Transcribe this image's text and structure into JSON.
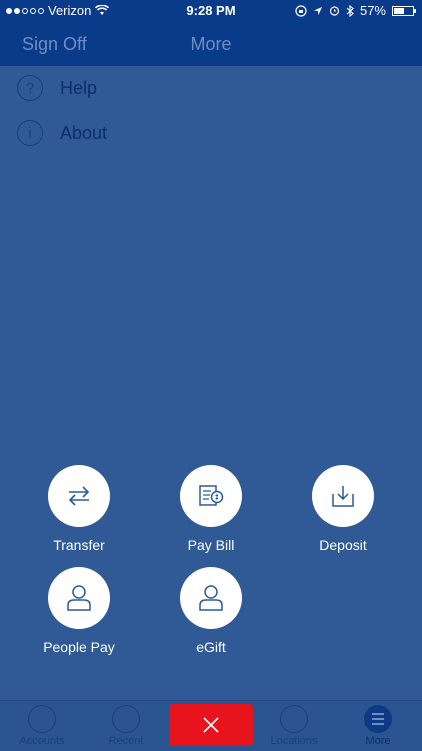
{
  "status_bar": {
    "carrier": "Verizon",
    "time": "9:28 PM",
    "battery": "57%",
    "battery_level": 0.57,
    "signal_bars_filled": 2,
    "signal_bars_total": 5,
    "icons": [
      "wifi-icon",
      "lock-rotation-icon",
      "location-icon",
      "alarm-icon",
      "bluetooth-icon",
      "battery-icon"
    ]
  },
  "nav_bar": {
    "left_label": "Sign Off",
    "title": "More"
  },
  "menu": {
    "items": [
      {
        "label": "Help",
        "icon": "help-icon",
        "glyph": "?"
      },
      {
        "label": "About",
        "icon": "info-icon",
        "glyph": "i"
      }
    ]
  },
  "actions": [
    {
      "label": "Transfer",
      "icon": "transfer-icon"
    },
    {
      "label": "Pay Bill",
      "icon": "pay-bill-icon"
    },
    {
      "label": "Deposit",
      "icon": "deposit-icon"
    },
    {
      "label": "People Pay",
      "icon": "person-icon"
    },
    {
      "label": "eGift",
      "icon": "person-icon"
    }
  ],
  "tab_bar": {
    "tabs": [
      {
        "label": "Accounts",
        "icon": "accounts-icon"
      },
      {
        "label": "Recent",
        "icon": "clock-icon"
      },
      {
        "label": "Locations",
        "icon": "location-pin-icon"
      },
      {
        "label": "More",
        "icon": "menu-icon"
      }
    ],
    "close_icon": "close-icon"
  },
  "colors": {
    "header": "#0a3a8a",
    "overlay": "#2f5a95",
    "close_button": "#e8141d",
    "action_icon": "#2a5a9a"
  }
}
